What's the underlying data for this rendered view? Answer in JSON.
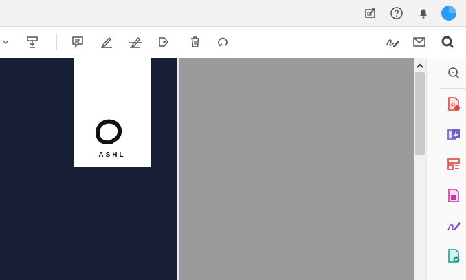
{
  "topbar": {
    "icons": [
      "share-screen-icon",
      "help-icon",
      "notifications-bell-icon",
      "profile-avatar-icon"
    ],
    "avatar_color": "#2b9bf4"
  },
  "toolbar": {
    "icons": [
      "dropdown-caret-icon",
      "stamp-icon",
      "sticky-note-icon",
      "highlight-pen-icon",
      "strikethrough-pen-icon",
      "attach-file-icon",
      "delete-icon",
      "undo-icon",
      "sign-icon",
      "email-icon",
      "zoom-search-icon"
    ]
  },
  "document": {
    "logo_text": "ASHL",
    "left_background": "#171f36",
    "right_background": "#9b9b9b"
  },
  "tools_rail": {
    "icons": [
      "zoom-tool-icon",
      "export-pdf-icon",
      "create-pdf-icon",
      "organize-pages-icon",
      "compress-pdf-icon",
      "fill-sign-icon",
      "edit-pdf-icon"
    ],
    "colors": [
      "#e0443b",
      "#6b5fd3",
      "#e0443b",
      "#c43a9a",
      "#8c4ad1",
      "#1e9c8f"
    ]
  }
}
